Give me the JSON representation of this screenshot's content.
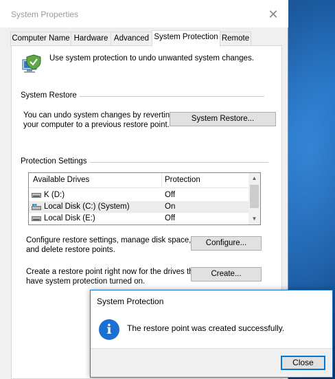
{
  "window": {
    "title": "System Properties",
    "close_glyph": "✕"
  },
  "tabs": [
    {
      "label": "Computer Name"
    },
    {
      "label": "Hardware"
    },
    {
      "label": "Advanced"
    },
    {
      "label": "System Protection",
      "active": true
    },
    {
      "label": "Remote"
    }
  ],
  "intro": {
    "text": "Use system protection to undo unwanted system changes.",
    "icon": "system-protection-icon"
  },
  "system_restore": {
    "group_title": "System Restore",
    "description_line1": "You can undo system changes by reverting",
    "description_line2": "your computer to a previous restore point.",
    "button_label": "System Restore..."
  },
  "protection_settings": {
    "group_title": "Protection Settings",
    "columns": [
      "Available Drives",
      "Protection"
    ],
    "drives": [
      {
        "name": "K (D:)",
        "protection": "Off",
        "icon": "drive-icon",
        "selected": false
      },
      {
        "name": "Local Disk (C:) (System)",
        "protection": "On",
        "icon": "system-drive-icon",
        "selected": true
      },
      {
        "name": "Local Disk (E:)",
        "protection": "Off",
        "icon": "drive-icon",
        "selected": false
      }
    ],
    "configure_text_line1": "Configure restore settings, manage disk space,",
    "configure_text_line2": "and delete restore points.",
    "configure_button": "Configure...",
    "create_text_line1": "Create a restore point right now for the drives that",
    "create_text_line2": "have system protection turned on.",
    "create_button": "Create..."
  },
  "dialog": {
    "title": "System Protection",
    "icon": "info-icon",
    "icon_glyph": "i",
    "message": "The restore point was created successfully.",
    "close_button": "Close"
  },
  "colors": {
    "accent": "#0078d7",
    "info": "#1a6fd0",
    "desktop": "#0f4a8c"
  }
}
